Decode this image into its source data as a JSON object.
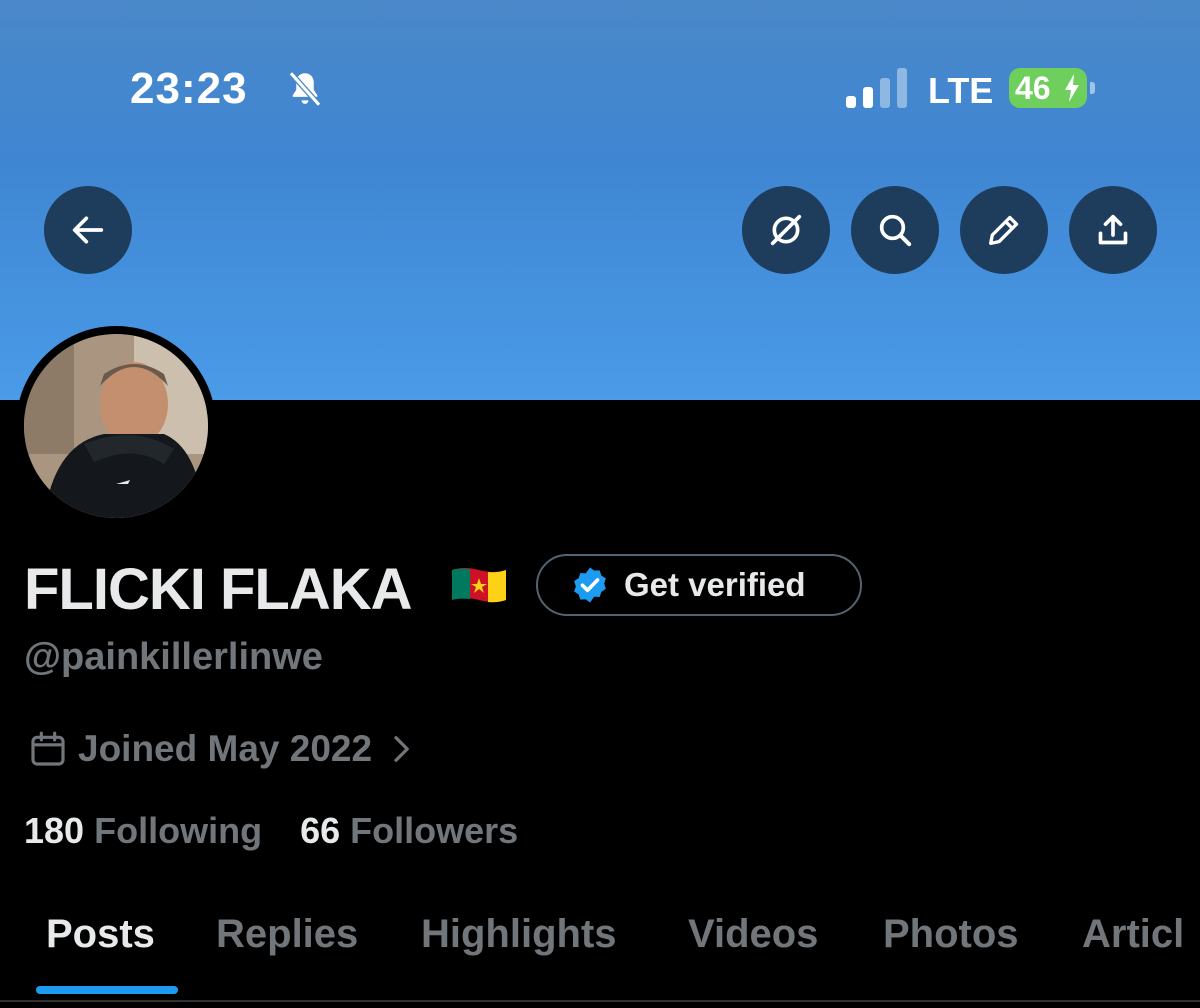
{
  "status_bar": {
    "time": "23:23",
    "network": "LTE",
    "battery": "46"
  },
  "icons": {
    "back": "arrow-left-icon",
    "grok": "grok-icon",
    "search": "search-icon",
    "edit": "pencil-icon",
    "share": "share-icon",
    "bell_muted": "bell-slash-icon",
    "verified": "verified-badge-icon",
    "calendar": "calendar-icon",
    "chevron": "chevron-right-icon"
  },
  "profile": {
    "name": "FLICKI FLAKA",
    "handle": "@painkillerlinwe",
    "get_verified_label": "Get verified",
    "joined": "Joined May 2022",
    "following_count": "180",
    "following_label": "Following",
    "followers_count": "66",
    "followers_label": "Followers"
  },
  "tabs": [
    {
      "label": "Posts"
    },
    {
      "label": "Replies"
    },
    {
      "label": "Highlights"
    },
    {
      "label": "Videos"
    },
    {
      "label": "Photos"
    },
    {
      "label": "Articl"
    }
  ],
  "colors": {
    "accent": "#1d9bf0",
    "banner": "#4a9be8",
    "secondary_text": "#71767b"
  }
}
